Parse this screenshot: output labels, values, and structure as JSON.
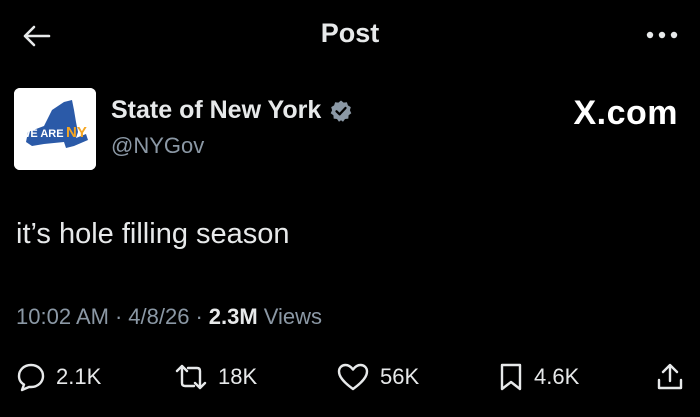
{
  "header": {
    "title": "Post"
  },
  "author": {
    "name": "State of New York",
    "handle": "@NYGov",
    "avatar_text": "WE ARE",
    "avatar_brand": "NY"
  },
  "watermark": "X.com",
  "post": {
    "text": "it’s hole filling season"
  },
  "meta": {
    "time": "10:02 AM",
    "sep1": "·",
    "date": "4/8/26",
    "sep2": "·",
    "views_count": "2.3M",
    "views_label": "Views"
  },
  "actions": {
    "replies": "2.1K",
    "reposts": "18K",
    "likes": "56K",
    "bookmarks": "4.6K"
  },
  "colors": {
    "background": "#000000",
    "text": "#e7e9ea",
    "muted": "#8b98a5",
    "verified": "#1d9bf0",
    "ny_blue": "#2b5aa8",
    "ny_orange": "#f5a623"
  },
  "icons": [
    "back-arrow-icon",
    "more-icon",
    "verified-badge-icon",
    "reply-icon",
    "repost-icon",
    "like-icon",
    "bookmark-icon",
    "share-icon"
  ]
}
